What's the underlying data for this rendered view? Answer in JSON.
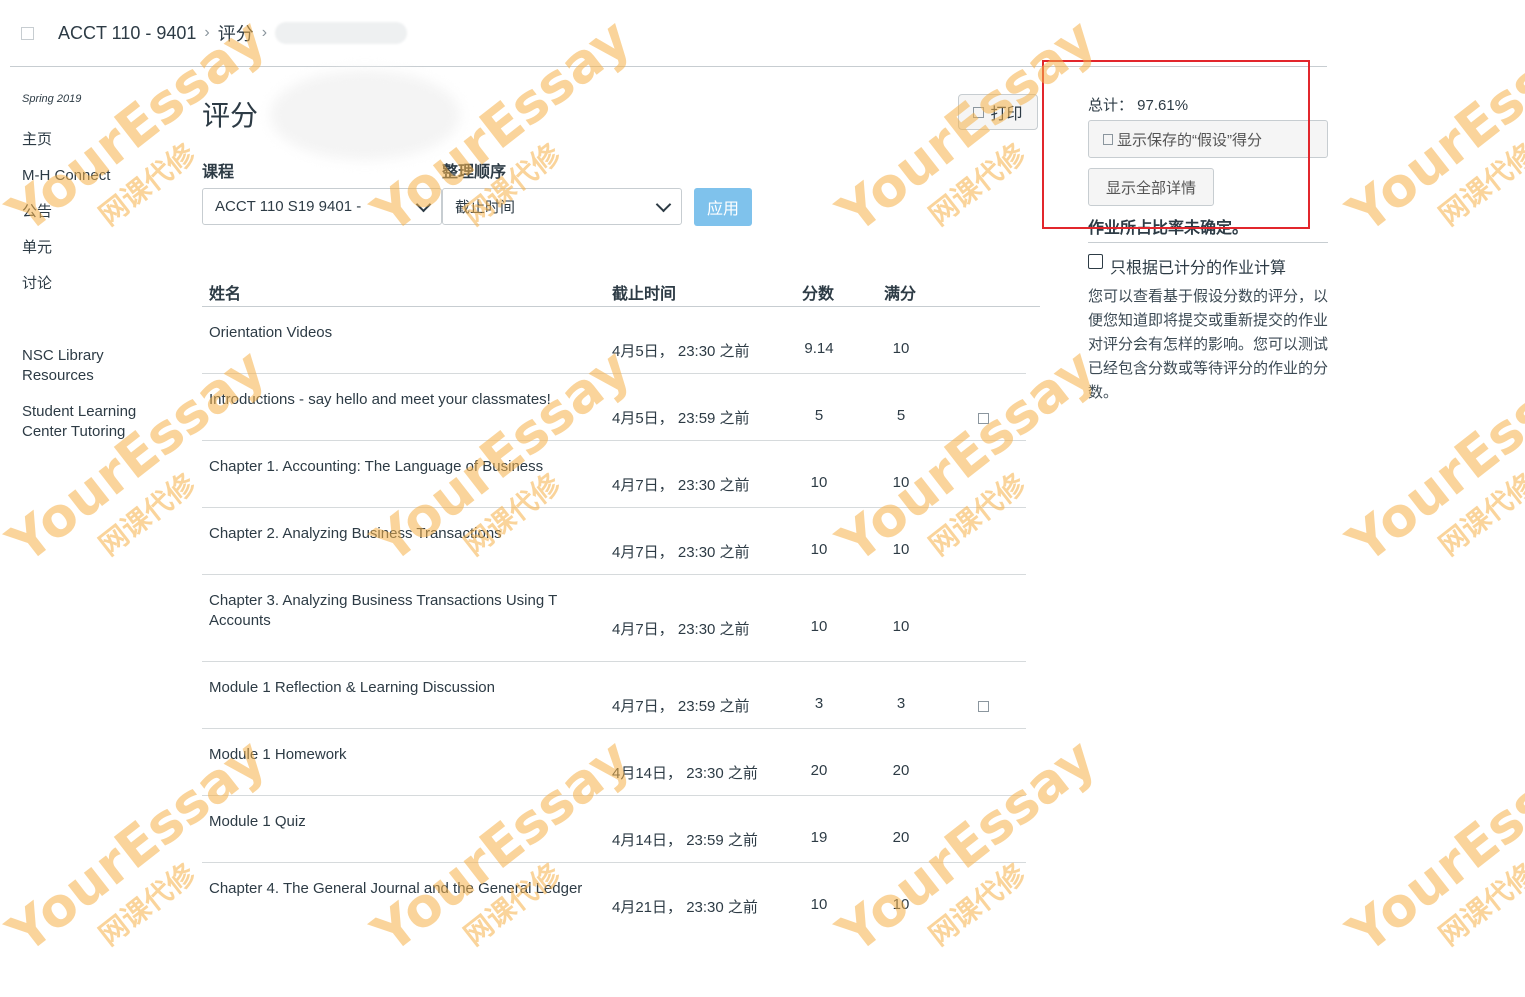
{
  "breadcrumb": {
    "course": "ACCT 110 - 9401",
    "section": "评分"
  },
  "sidebar": {
    "term": "Spring 2019",
    "items": [
      {
        "label": "主页"
      },
      {
        "label": "M-H Connect"
      },
      {
        "label": "公告"
      },
      {
        "label": "单元"
      },
      {
        "label": "讨论"
      },
      {
        "label": "NSC Library Resources"
      },
      {
        "label": "Student Learning Center Tutoring"
      }
    ]
  },
  "main": {
    "title": "评分",
    "print_label": "打印",
    "course_label": "课程",
    "course_value": "ACCT 110 S19 9401 -",
    "sort_label": "整理顺序",
    "sort_value": "截止时间",
    "apply_label": "应用",
    "columns": [
      "姓名",
      "截止时间",
      "分数",
      "满分"
    ],
    "rows": [
      {
        "name": "Orientation Videos",
        "due": "4月5日， 23:30 之前",
        "score": "9.14",
        "max": "10",
        "icon": false
      },
      {
        "name": "Introductions - say hello and meet your classmates!",
        "due": "4月5日， 23:59 之前",
        "score": "5",
        "max": "5",
        "icon": true
      },
      {
        "name": "Chapter 1. Accounting: The Language of Business",
        "due": "4月7日， 23:30 之前",
        "score": "10",
        "max": "10",
        "icon": false
      },
      {
        "name": "Chapter 2. Analyzing Business Transactions",
        "due": "4月7日， 23:30 之前",
        "score": "10",
        "max": "10",
        "icon": false
      },
      {
        "name": "Chapter 3. Analyzing Business Transactions Using T Accounts",
        "due": "4月7日， 23:30 之前",
        "score": "10",
        "max": "10",
        "icon": false
      },
      {
        "name": "Module 1 Reflection & Learning Discussion",
        "due": "4月7日， 23:59 之前",
        "score": "3",
        "max": "3",
        "icon": true
      },
      {
        "name": "Module 1 Homework",
        "due": "4月14日， 23:30 之前",
        "score": "20",
        "max": "20",
        "icon": false
      },
      {
        "name": "Module 1 Quiz",
        "due": "4月14日， 23:59 之前",
        "score": "19",
        "max": "20",
        "icon": false
      },
      {
        "name": "Chapter 4. The General Journal and the General Ledger",
        "due": "4月21日， 23:30 之前",
        "score": "10",
        "max": "10",
        "icon": false
      }
    ]
  },
  "right_panel": {
    "total": "总计： 97.61%",
    "whatif_label": "显示保存的“假设”得分",
    "details_label": "显示全部详情",
    "weight_note": "作业所占比率未确定。",
    "graded_only_label": "只根据已计分的作业计算",
    "help_text": "您可以查看基于假设分数的评分，以便您知道即将提交或重新提交的作业对评分会有怎样的影响。您可以测试已经包含分数或等待评分的作业的分数。"
  },
  "watermark": {
    "brand": "YourEssay",
    "sub": "网课代修"
  },
  "colors": {
    "highlight": "#e2262c",
    "apply": "#7fc2ec",
    "watermark": "#f6b24a",
    "text": "#2d3b45"
  }
}
